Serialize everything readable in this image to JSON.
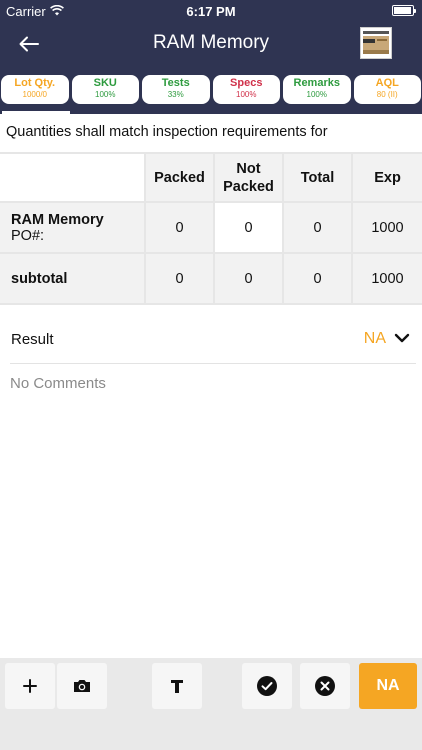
{
  "statusbar": {
    "carrier": "Carrier",
    "time": "6:17 PM"
  },
  "navbar": {
    "title": "RAM Memory"
  },
  "tabs": [
    {
      "label": "Lot Qty.",
      "value": "1000/0",
      "color": "#f5a623"
    },
    {
      "label": "SKU",
      "value": "100%",
      "color": "#2e9b3f"
    },
    {
      "label": "Tests",
      "value": "33%",
      "color": "#2e9b3f"
    },
    {
      "label": "Specs",
      "value": "100%",
      "color": "#d0314a"
    },
    {
      "label": "Remarks",
      "value": "100%",
      "color": "#2e9b3f"
    },
    {
      "label": "AQL",
      "value": "80 (II)",
      "color": "#f5a623"
    }
  ],
  "description": "Quantities shall match inspection requirements for",
  "table": {
    "headers": [
      "Packed",
      "Not Packed",
      "Total",
      "Exp"
    ],
    "rows": [
      {
        "name": "RAM Memory",
        "sub": "PO#:",
        "packed": "0",
        "not_packed": "0",
        "total": "0",
        "exp": "1000"
      },
      {
        "name": "subtotal",
        "sub": "",
        "packed": "0",
        "not_packed": "0",
        "total": "0",
        "exp": "1000"
      }
    ]
  },
  "result": {
    "label": "Result",
    "value": "NA"
  },
  "comments": {
    "placeholder": "No Comments"
  },
  "toolbar": {
    "na_label": "NA"
  },
  "colors": {
    "nav_bg": "#2f3452",
    "accent_orange": "#f5a623",
    "accent_green": "#2e9b3f",
    "accent_red": "#d0314a"
  }
}
